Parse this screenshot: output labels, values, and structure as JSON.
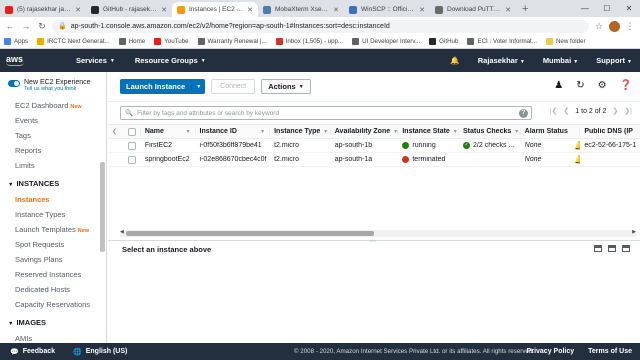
{
  "browser": {
    "tabs": [
      {
        "label": "(5) rajasekhar java -",
        "icon_color": "#e62117",
        "active": false
      },
      {
        "label": "GitHub - rajasekhar",
        "icon_color": "#24292e",
        "active": false
      },
      {
        "label": "Instances | EC2 Man",
        "icon_color": "#ff9900",
        "active": true
      },
      {
        "label": "MobaXterm Xserver",
        "icon_color": "#4a7fb5",
        "active": false
      },
      {
        "label": "WinSCP :: Official Si",
        "icon_color": "#3a6fc4",
        "active": false
      },
      {
        "label": "Download PuTTY: la",
        "icon_color": "#6b6b6b",
        "active": false
      }
    ],
    "url": "ap-south-1.console.aws.amazon.com/ec2/v2/home?region=ap-south-1#Instances:sort=desc:instanceId",
    "bookmarks": [
      {
        "label": "Apps",
        "icon_color": "#4285f4"
      },
      {
        "label": "IRCTC Next Generat...",
        "icon_color": "#f2a900"
      },
      {
        "label": "Home",
        "icon_color": "#5f6368"
      },
      {
        "label": "YouTube",
        "icon_color": "#e62117"
      },
      {
        "label": "Warranty Renewal |...",
        "icon_color": "#5f6368"
      },
      {
        "label": "Inbox (1,505) - upp...",
        "icon_color": "#d93025"
      },
      {
        "label": "UI Developer Interv...",
        "icon_color": "#5f6368"
      },
      {
        "label": "GitHub",
        "icon_color": "#24292e"
      },
      {
        "label": "ECI : Voter Informat...",
        "icon_color": "#5f6368"
      },
      {
        "label": "New folder",
        "icon_color": "#f2c94c"
      }
    ]
  },
  "aws": {
    "logo": "aws",
    "services": "Services",
    "resource_groups": "Resource Groups",
    "user": "Rajasekhar",
    "region": "Mumbai",
    "support": "Support"
  },
  "sidebar": {
    "experience_title": "New EC2 Experience",
    "experience_sub": "Tell us what you think",
    "top_items": [
      {
        "label": "EC2 Dashboard",
        "badge": "New"
      },
      {
        "label": "Events",
        "badge": ""
      },
      {
        "label": "Tags",
        "badge": ""
      },
      {
        "label": "Reports",
        "badge": ""
      },
      {
        "label": "Limits",
        "badge": ""
      }
    ],
    "instances_header": "INSTANCES",
    "instance_items": [
      {
        "label": "Instances",
        "badge": "",
        "active": true
      },
      {
        "label": "Instance Types",
        "badge": ""
      },
      {
        "label": "Launch Templates",
        "badge": "New"
      },
      {
        "label": "Spot Requests",
        "badge": ""
      },
      {
        "label": "Savings Plans",
        "badge": ""
      },
      {
        "label": "Reserved Instances",
        "badge": ""
      },
      {
        "label": "Dedicated Hosts",
        "badge": ""
      },
      {
        "label": "Capacity Reservations",
        "badge": ""
      }
    ],
    "images_header": "IMAGES",
    "image_items": [
      {
        "label": "AMIs"
      }
    ]
  },
  "toolbar": {
    "launch": "Launch Instance",
    "connect": "Connect",
    "actions": "Actions"
  },
  "filter": {
    "placeholder": "Filter by tags and attributes or search by keyword",
    "pager": "1 to 2 of 2"
  },
  "table": {
    "headers": {
      "name": "Name",
      "id": "Instance ID",
      "type": "Instance Type",
      "az": "Availability Zone",
      "state": "Instance State",
      "checks": "Status Checks",
      "alarm": "Alarm Status",
      "dns": "Public DNS (IP"
    },
    "rows": [
      {
        "name": "FirstEC2",
        "id": "i-0f50f3b6ff879be41",
        "type": "t2.micro",
        "az": "ap-south-1b",
        "state": "running",
        "state_color": "#1d8102",
        "checks": "2/2 checks ...",
        "alarm": "None",
        "dns": "ec2-52-66-175-1"
      },
      {
        "name": "springbootEc2",
        "id": "i-02e868670cbec4c0f",
        "type": "t2.micro",
        "az": "ap-south-1a",
        "state": "terminated",
        "state_color": "#d13212",
        "checks": "",
        "alarm": "None",
        "dns": ""
      }
    ]
  },
  "detail": {
    "prompt": "Select an instance above"
  },
  "footer": {
    "feedback": "Feedback",
    "language": "English (US)",
    "copyright": "© 2008 - 2020, Amazon Internet Services Private Ltd. or its affiliates. All rights reserved.",
    "privacy": "Privacy Policy",
    "terms": "Terms of Use"
  }
}
